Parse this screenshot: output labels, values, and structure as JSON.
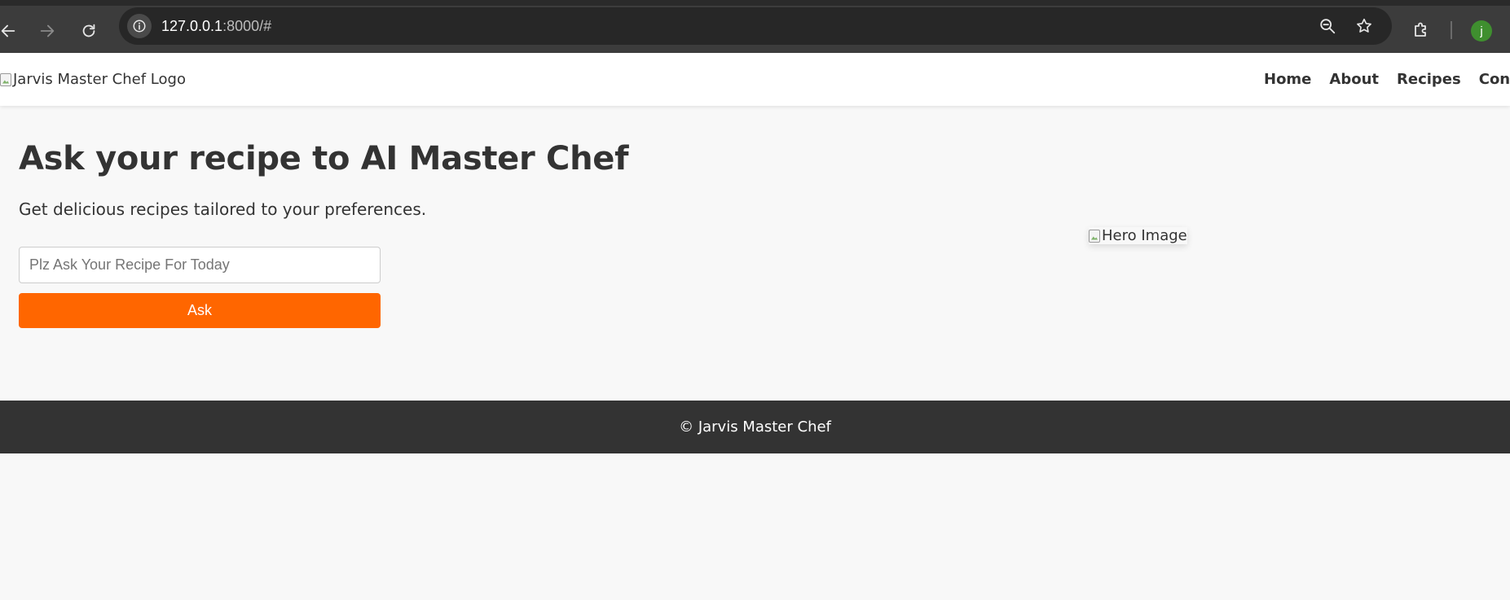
{
  "browser": {
    "url_host": "127.0.0.1",
    "url_path": ":8000/#",
    "profile_initial": "j"
  },
  "header": {
    "logo_alt": "Jarvis Master Chef Logo",
    "nav": [
      {
        "label": "Home"
      },
      {
        "label": "About"
      },
      {
        "label": "Recipes"
      },
      {
        "label": "Contact"
      }
    ]
  },
  "hero": {
    "title": "Ask your recipe to AI Master Chef",
    "subtitle": "Get delicious recipes tailored to your preferences.",
    "input_placeholder": "Plz Ask Your Recipe For Today",
    "input_value": "",
    "ask_label": "Ask",
    "image_alt": "Hero Image"
  },
  "footer": {
    "text": "© Jarvis Master Chef"
  },
  "colors": {
    "accent": "#ff6600",
    "text": "#333333",
    "footer_bg": "#333333",
    "page_bg": "#f8f8f8",
    "chrome_bg": "#3c3c3c",
    "omnibox_bg": "#272727",
    "avatar_bg": "#3f8f2f"
  },
  "icons": {
    "back": "arrow-left-icon",
    "forward": "arrow-right-icon",
    "reload": "reload-icon",
    "site_info": "info-icon",
    "zoom": "zoom-out-icon",
    "bookmark": "star-icon",
    "extensions": "puzzle-icon",
    "broken_image": "broken-image-icon"
  }
}
